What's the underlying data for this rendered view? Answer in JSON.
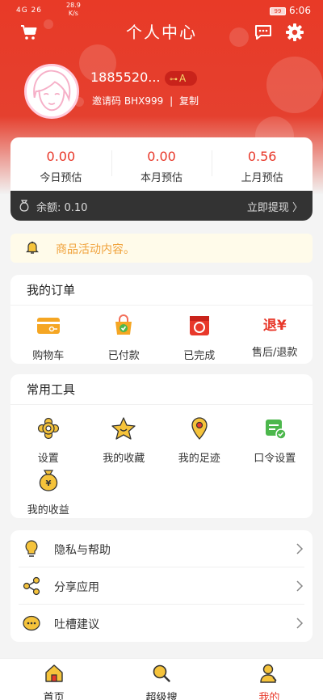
{
  "status_bar": {
    "signal": "4G 26",
    "speed": "28.9",
    "speed_unit": "K/s",
    "battery": "99",
    "time": "6:06"
  },
  "header": {
    "title": "个人中心"
  },
  "profile": {
    "phone": "1885520...",
    "level_badge": "A",
    "invite_label": "邀请码",
    "invite_code": "BHX999",
    "separator": "|",
    "copy_label": "复制"
  },
  "stats": [
    {
      "value": "0.00",
      "label": "今日预估"
    },
    {
      "value": "0.00",
      "label": "本月预估"
    },
    {
      "value": "0.56",
      "label": "上月预估"
    }
  ],
  "balance": {
    "label": "余额: 0.10",
    "withdraw": "立即提现 〉"
  },
  "notice": {
    "text": "商品活动内容。"
  },
  "orders": {
    "title": "我的订单",
    "items": [
      {
        "label": "购物车",
        "icon": "wallet-icon"
      },
      {
        "label": "已付款",
        "icon": "paid-bag-icon"
      },
      {
        "label": "已完成",
        "icon": "completed-box-icon"
      },
      {
        "label": "售后/退款",
        "icon": "refund-icon",
        "glyph": "退¥"
      }
    ]
  },
  "tools": {
    "title": "常用工具",
    "items": [
      {
        "label": "设置",
        "icon": "settings-icon"
      },
      {
        "label": "我的收藏",
        "icon": "star-icon"
      },
      {
        "label": "我的足迹",
        "icon": "location-icon"
      },
      {
        "label": "口令设置",
        "icon": "command-icon"
      },
      {
        "label": "我的收益",
        "icon": "money-bag-icon"
      }
    ]
  },
  "menu": [
    {
      "label": "隐私与帮助",
      "icon": "lightbulb-icon"
    },
    {
      "label": "分享应用",
      "icon": "share-icon"
    },
    {
      "label": "吐槽建议",
      "icon": "chat-icon"
    }
  ],
  "bottom_nav": [
    {
      "label": "首页",
      "icon": "home-icon"
    },
    {
      "label": "超级搜",
      "icon": "search-icon"
    },
    {
      "label": "我的",
      "icon": "profile-icon",
      "active": true
    }
  ],
  "colors": {
    "brand_red": "#e5402f",
    "accent_red": "#e8382a",
    "notice_text": "#f0a23b",
    "icon_orange": "#f5a623",
    "dark_bar": "#333333"
  }
}
